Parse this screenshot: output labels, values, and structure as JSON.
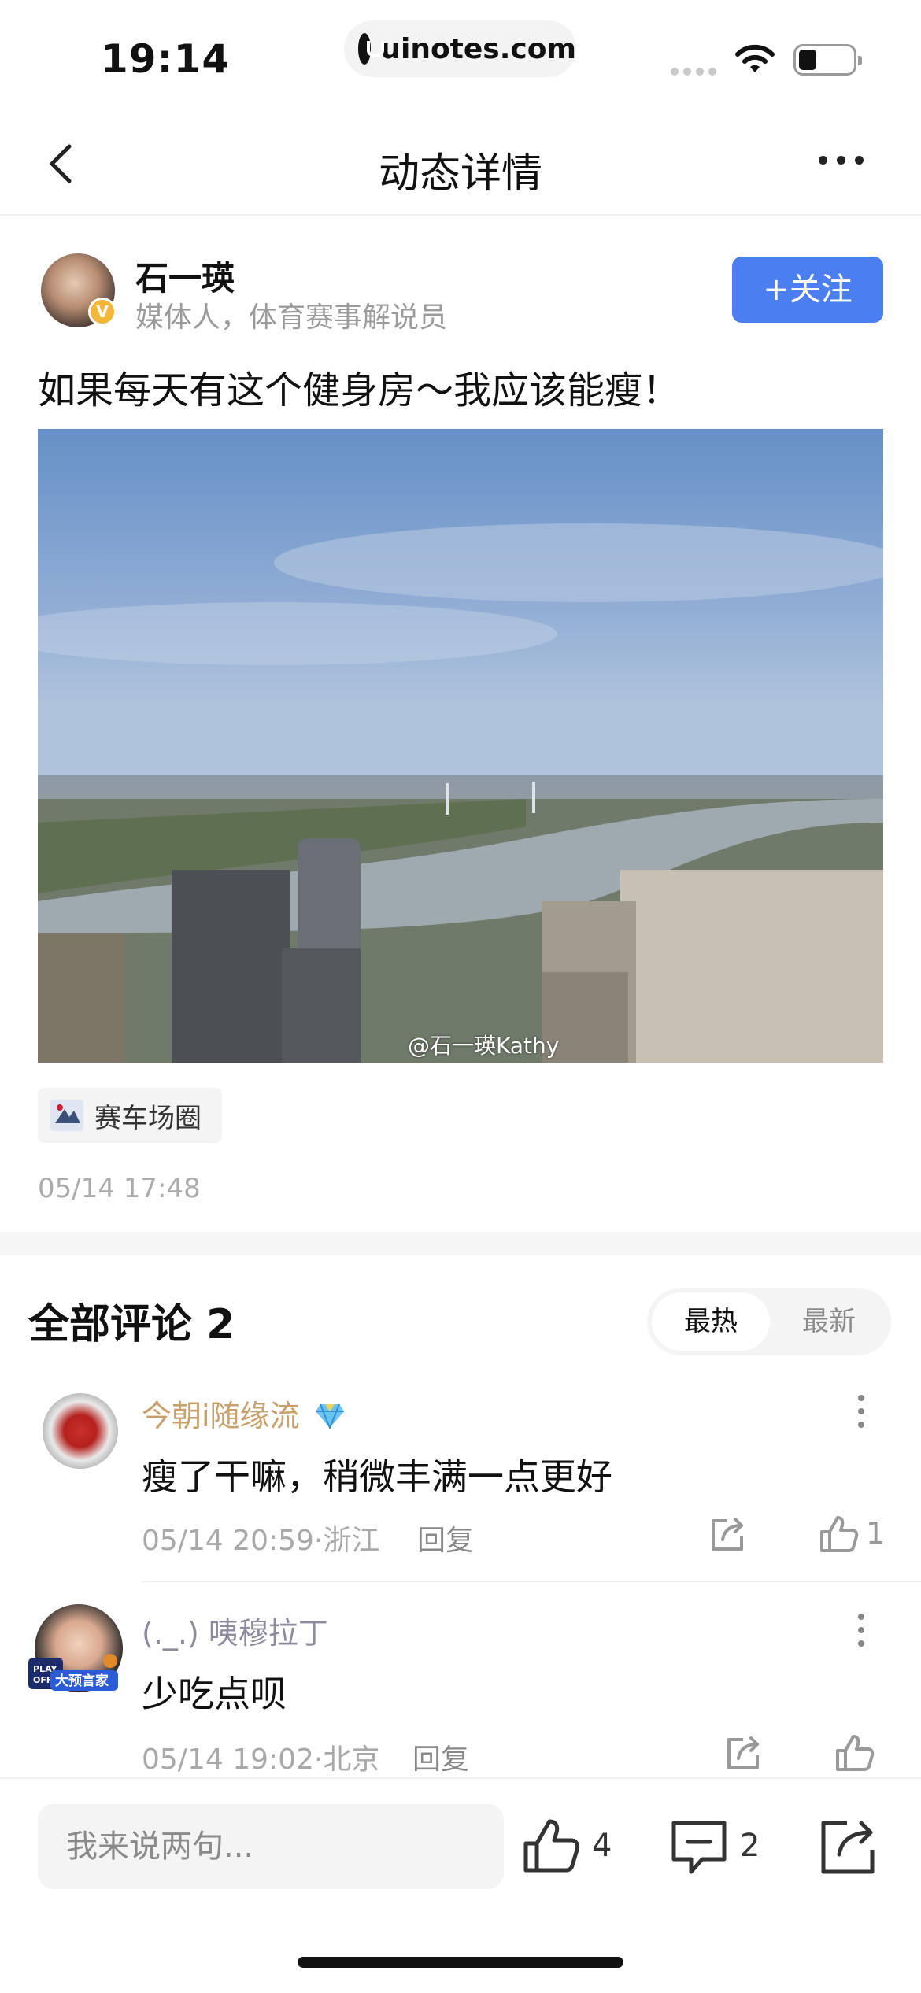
{
  "status_bar": {
    "time": "19:14",
    "url": "uinotes.com",
    "icons": [
      "signal-icon",
      "wifi-icon",
      "battery-icon"
    ]
  },
  "nav": {
    "title": "动态详情",
    "back_icon": "chevron-left-icon",
    "more_icon": "more-horizontal-icon"
  },
  "post": {
    "author": {
      "name": "石一瑛",
      "description": "媒体人，体育赛事解说员",
      "verified_mark": "V"
    },
    "follow_label": "+关注",
    "text": "如果每天有这个健身房～我应该能瘦！",
    "image_watermark": "@石一瑛Kathy",
    "tag": "赛车场圈",
    "time": "05/14 17:48"
  },
  "comments": {
    "title": "全部评论 2",
    "sort_options": [
      "最热",
      "最新"
    ],
    "selected_sort": "最热",
    "items": [
      {
        "name": "今朝i随缘流",
        "text": "瘦了干嘛，稍微丰满一点更好",
        "meta": "05/14 20:59·浙江",
        "reply_label": "回复",
        "like_count": "1"
      },
      {
        "name": "(._.) 咦穆拉丁",
        "text": "少吃点呗",
        "meta": "05/14 19:02·北京",
        "reply_label": "回复",
        "like_count": "",
        "badge_text": "大预言家"
      }
    ]
  },
  "bottom_bar": {
    "input_placeholder": "我来说两句...",
    "like_count": "4",
    "comment_count": "2"
  },
  "colors": {
    "accent": "#4b7ef0",
    "vip_name": "#c8a06c",
    "muted": "#a9a9a9"
  }
}
